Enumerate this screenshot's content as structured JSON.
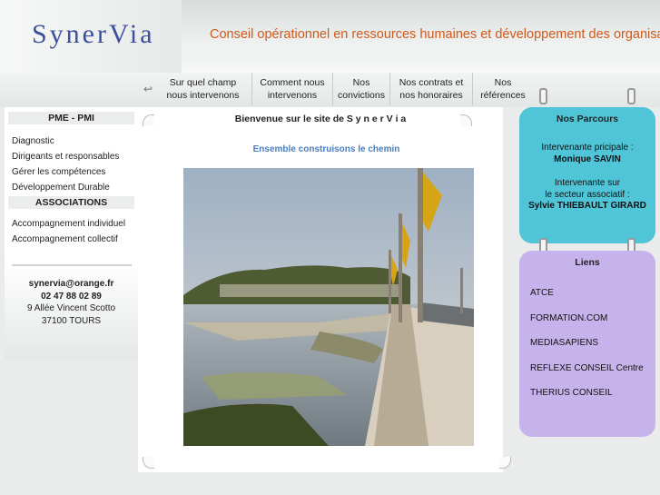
{
  "header": {
    "logo": "SynerVia",
    "tagline": "Conseil opérationnel en ressources humaines et développement des organisations"
  },
  "nav": [
    {
      "l1": "Sur quel champ",
      "l2": "nous intervenons"
    },
    {
      "l1": "Comment nous",
      "l2": "intervenons"
    },
    {
      "l1": "Nos",
      "l2": "convictions"
    },
    {
      "l1": "Nos contrats et",
      "l2": "nos honoraires"
    },
    {
      "l1": "Nos",
      "l2": "références"
    }
  ],
  "sidebar": {
    "pme_title": "PME - PMI",
    "pme_items": [
      "Diagnostic",
      "Dirigeants et responsables",
      "Gérer les compétences",
      "Développement Durable"
    ],
    "assoc_title": "ASSOCIATIONS",
    "assoc_items": [
      "Accompagnement individuel",
      "Accompagnement collectif"
    ],
    "contact": {
      "email": "synervia@orange.fr",
      "phone": "02 47 88 02 89",
      "address": "9 Allée Vincent Scotto",
      "city": "37100 TOURS"
    }
  },
  "main": {
    "welcome": "Bienvenue sur le site de S y n e r V i a",
    "slogan": "Ensemble construisons le chemin"
  },
  "parcours": {
    "title": "Nos Parcours",
    "l1": "Intervenante pricipale :",
    "name1": "Monique SAVIN",
    "l2": "Intervenante sur",
    "l3": "le secteur associatif :",
    "name2": "Sylvie THIEBAULT GIRARD"
  },
  "liens": {
    "title": "Liens",
    "items": [
      "ATCE",
      "FORMATION.COM",
      "MEDIASAPIENS",
      "REFLEXE CONSEIL Centre",
      "THERIUS CONSEIL"
    ]
  }
}
